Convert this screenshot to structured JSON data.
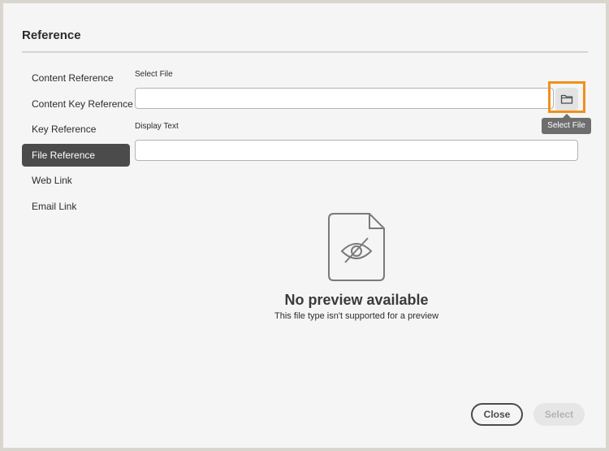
{
  "dialog": {
    "title": "Reference"
  },
  "nav": {
    "items": [
      {
        "label": "Content Reference",
        "selected": false
      },
      {
        "label": "Content Key Reference",
        "selected": false
      },
      {
        "label": "Key Reference",
        "selected": false
      },
      {
        "label": "File Reference",
        "selected": true
      },
      {
        "label": "Web Link",
        "selected": false
      },
      {
        "label": "Email Link",
        "selected": false
      }
    ]
  },
  "form": {
    "select_file_label": "Select File",
    "select_file_value": "",
    "display_text_label": "Display Text",
    "display_text_value": "",
    "browse_icon": "folder-icon",
    "tooltip": "Select File"
  },
  "preview": {
    "icon": "eye-slash-file-icon",
    "title": "No preview available",
    "subtitle": "This file type isn't supported for a preview"
  },
  "footer": {
    "close_label": "Close",
    "select_label": "Select"
  },
  "colors": {
    "highlight": "#f0901c",
    "selected_nav": "#4b4b4b",
    "background": "#f5f5f5"
  }
}
